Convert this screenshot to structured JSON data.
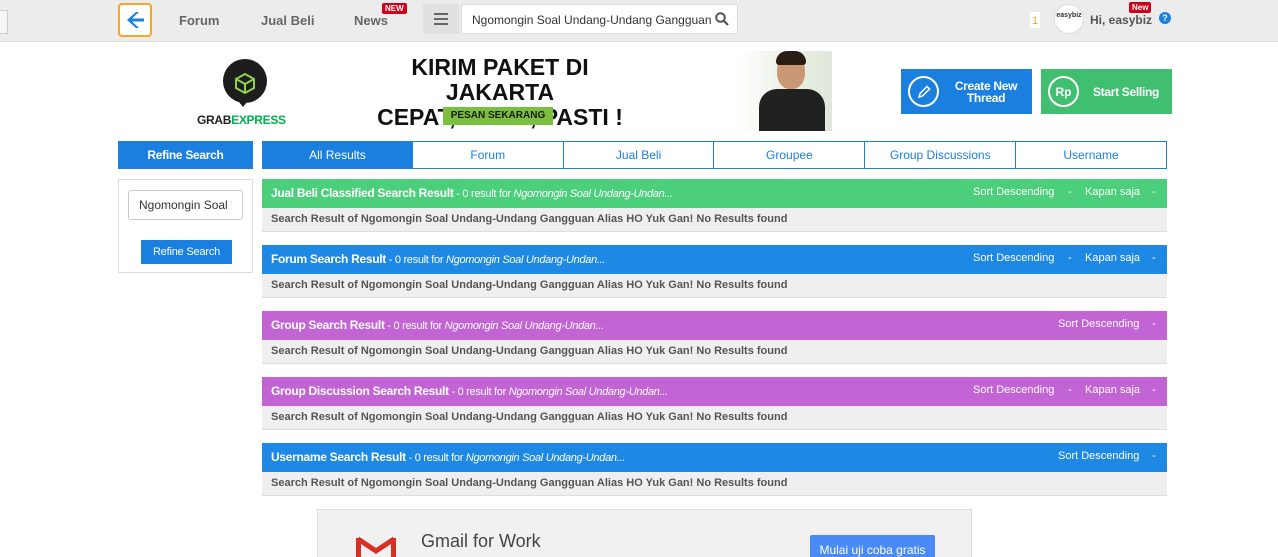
{
  "header": {
    "nav": [
      {
        "label": "Forum"
      },
      {
        "label": "Jual Beli"
      },
      {
        "label": "News",
        "badge": "NEW"
      }
    ],
    "search_value": "Ngomongin Soal Undang-Undang Gangguan",
    "notification_count": "1",
    "avatar_text_1": "easybiz",
    "avatar_text_2": "",
    "greeting": "Hi, easybiz",
    "greeting_badge": "New",
    "help": "?"
  },
  "banner": {
    "brand_1": "GRAB",
    "brand_2": "EXPRESS",
    "headline_1": "KIRIM PAKET DI JAKARTA",
    "headline_2": "CEPAT, AMAN, PASTI !",
    "cta": "PESAN SEKARANG"
  },
  "actions": {
    "create_thread": "Create New Thread",
    "start_selling": "Start Selling",
    "rp": "Rp"
  },
  "sidebar": {
    "title": "Refine Search",
    "input_value": "Ngomongin Soal Undang-Undang Gangguan",
    "button": "Refine Search"
  },
  "tabs": [
    "All Results",
    "Forum",
    "Jual Beli",
    "Groupee",
    "Group Discussions",
    "Username"
  ],
  "results": [
    {
      "title": "Jual Beli Classified Search Result",
      "count_text": " - 0 result for ",
      "query": "Ngomongin Soal Undang-Undan...",
      "sort": "Sort Descending",
      "time": "Kapan saja",
      "message": "Search Result of Ngomongin Soal Undang-Undang Gangguan Alias HO Yuk Gan! No Results found",
      "color": "#4ccf7b"
    },
    {
      "title": "Forum Search Result",
      "count_text": " - 0 result for ",
      "query": "Ngomongin Soal Undang-Undan...",
      "sort": "Sort Descending",
      "time": "Kapan saja",
      "message": "Search Result of Ngomongin Soal Undang-Undang Gangguan Alias HO Yuk Gan! No Results found",
      "color": "#1e88e5"
    },
    {
      "title": "Group Search Result",
      "count_text": " - 0 result for ",
      "query": "Ngomongin Soal Undang-Undan...",
      "sort": "Sort Descending",
      "time": "",
      "message": "Search Result of Ngomongin Soal Undang-Undang Gangguan Alias HO Yuk Gan! No Results found",
      "color": "#c264d4"
    },
    {
      "title": "Group Discussion Search Result",
      "count_text": " - 0 result for ",
      "query": "Ngomongin Soal Undang-Undan...",
      "sort": "Sort Descending",
      "time": "Kapan saja",
      "message": "Search Result of Ngomongin Soal Undang-Undang Gangguan Alias HO Yuk Gan! No Results found",
      "color": "#c264d4"
    },
    {
      "title": "Username Search Result",
      "count_text": " - 0 result for ",
      "query": "Ngomongin Soal Undang-Undan...",
      "sort": "Sort Descending",
      "time": "",
      "message": "Search Result of Ngomongin Soal Undang-Undang Gangguan Alias HO Yuk Gan! No Results found",
      "color": "#1e88e5"
    }
  ],
  "ad": {
    "title": "Gmail for Work",
    "cta": "Mulai uji coba gratis"
  },
  "colors": {
    "primary": "#1b7fe0",
    "green": "#3fbf6f",
    "logo_border": "#f6a623",
    "new_badge": "#d0021b"
  }
}
